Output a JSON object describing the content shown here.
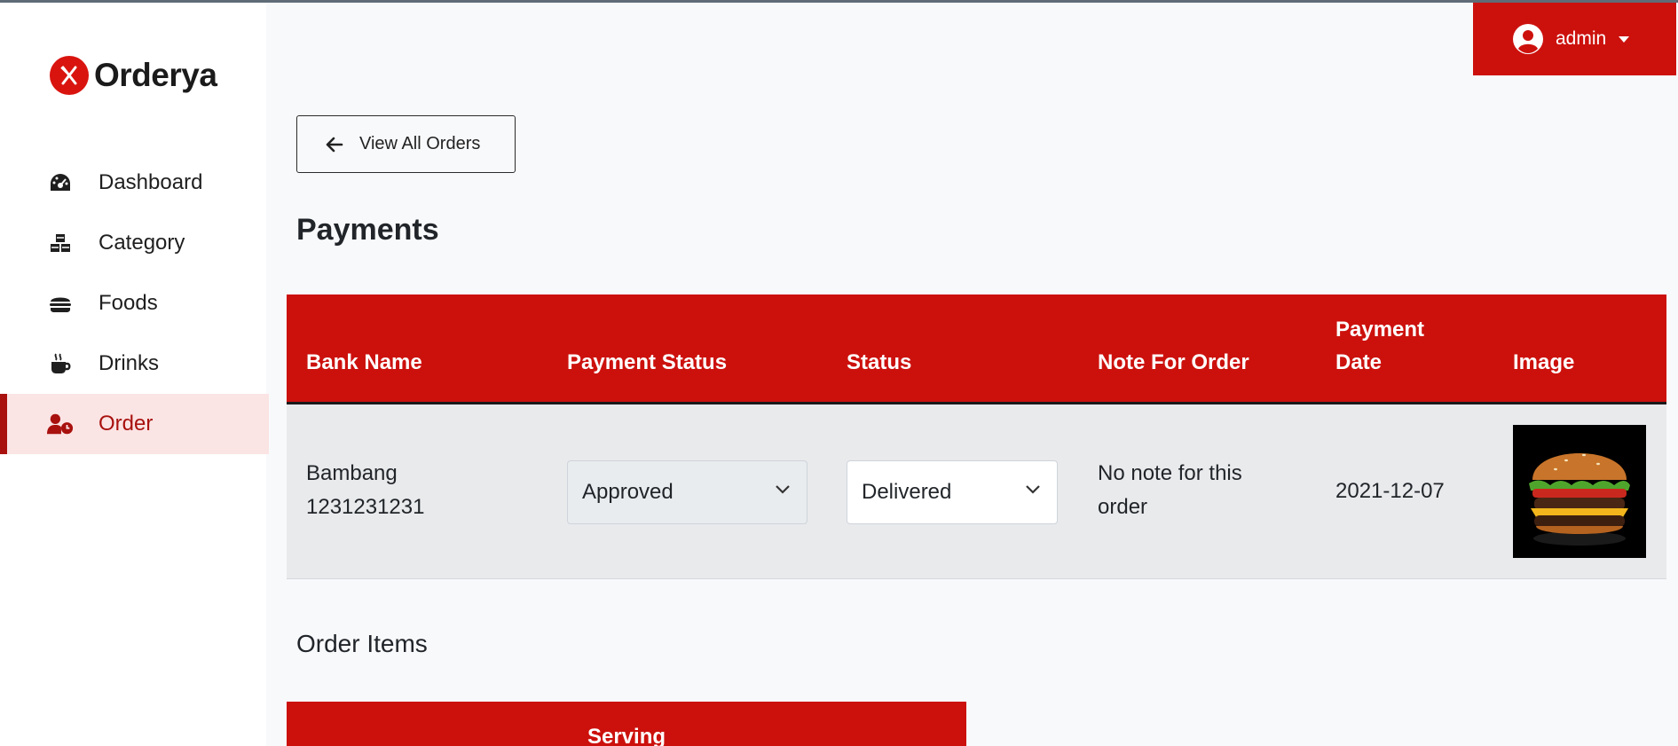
{
  "brand": {
    "name": "Orderya",
    "accent": "#cc110d"
  },
  "sidebar": {
    "items": [
      {
        "label": "Dashboard",
        "icon": "tachometer-icon"
      },
      {
        "label": "Category",
        "icon": "cubes-icon"
      },
      {
        "label": "Foods",
        "icon": "hamburger-icon"
      },
      {
        "label": "Drinks",
        "icon": "coffee-icon"
      },
      {
        "label": "Order",
        "icon": "user-clock-icon",
        "active": true
      }
    ]
  },
  "header": {
    "user_label": "admin"
  },
  "main": {
    "back_button": "View All Orders",
    "title": "Payments",
    "table": {
      "headers": {
        "bank_name": "Bank Name",
        "payment_status": "Payment Status",
        "status": "Status",
        "note": "Note For Order",
        "payment_date_l1": "Payment",
        "payment_date_l2": "Date",
        "image": "Image"
      },
      "row": {
        "bank_name_l1": "Bambang",
        "bank_name_l2": "1231231231",
        "payment_status": "Approved",
        "status": "Delivered",
        "note_l1": "No note for this",
        "note_l2": "order",
        "payment_date": "2021-12-07",
        "image_icon": "burger-photo"
      }
    },
    "order_items_title": "Order Items",
    "order_items_header": "Serving"
  }
}
